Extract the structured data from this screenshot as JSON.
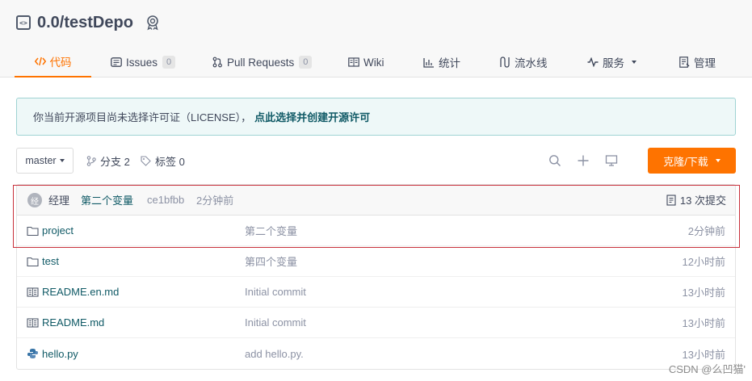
{
  "repo": {
    "name": "0.0/testDepo"
  },
  "tabs": [
    {
      "label": "代码",
      "icon": "code-icon",
      "active": true
    },
    {
      "label": "Issues",
      "count": "0",
      "icon": "issues-icon"
    },
    {
      "label": "Pull Requests",
      "count": "0",
      "icon": "pull-request-icon"
    },
    {
      "label": "Wiki",
      "icon": "wiki-icon"
    },
    {
      "label": "统计",
      "icon": "stats-icon"
    },
    {
      "label": "流水线",
      "icon": "pipeline-icon"
    },
    {
      "label": "服务",
      "icon": "service-icon",
      "dropdown": true
    },
    {
      "label": "管理",
      "icon": "manage-icon"
    }
  ],
  "license": {
    "notice": "你当前开源项目尚未选择许可证（LICENSE），",
    "link": "点此选择并创建开源许可"
  },
  "toolbar": {
    "branch": "master",
    "branches_label": "分支 2",
    "tags_label": "标签 0",
    "clone_label": "克隆/下载"
  },
  "latest_commit": {
    "avatar_letter": "经",
    "author": "经理",
    "message": "第二个变量",
    "sha": "ce1bfbb",
    "time": "2分钟前",
    "count_label": "13 次提交"
  },
  "files": [
    {
      "name": "project",
      "type": "folder",
      "commit": "第二个变量",
      "time": "2分钟前"
    },
    {
      "name": "test",
      "type": "folder",
      "commit": "第四个变量",
      "time": "12小时前"
    },
    {
      "name": "README.en.md",
      "type": "markdown",
      "commit": "Initial commit",
      "time": "13小时前"
    },
    {
      "name": "README.md",
      "type": "markdown",
      "commit": "Initial commit",
      "time": "13小时前"
    },
    {
      "name": "hello.py",
      "type": "python",
      "commit": "add hello.py.",
      "time": "13小时前"
    }
  ],
  "watermark": "CSDN @么凹猫'",
  "colors": {
    "accent": "#fe7300",
    "link": "#105a66",
    "highlight": "#c8303b"
  }
}
